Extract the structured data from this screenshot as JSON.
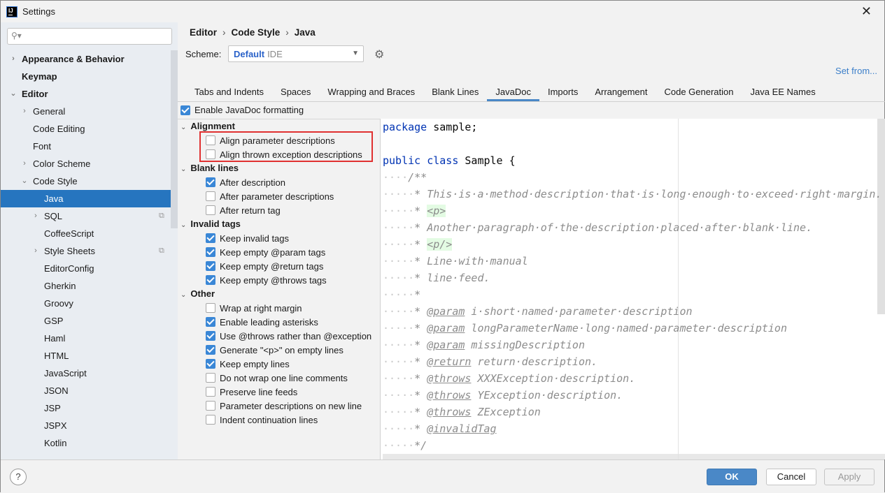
{
  "window": {
    "title": "Settings",
    "icon": "intellij-icon",
    "close": "✕"
  },
  "sidebar": {
    "search_placeholder": "",
    "items": [
      {
        "label": "Appearance & Behavior",
        "level": 0,
        "bold": true,
        "arrow": "›"
      },
      {
        "label": "Keymap",
        "level": 0,
        "bold": true,
        "arrow": ""
      },
      {
        "label": "Editor",
        "level": 0,
        "bold": true,
        "arrow": "⌄"
      },
      {
        "label": "General",
        "level": 1,
        "arrow": "›"
      },
      {
        "label": "Code Editing",
        "level": 1,
        "arrow": ""
      },
      {
        "label": "Font",
        "level": 1,
        "arrow": ""
      },
      {
        "label": "Color Scheme",
        "level": 1,
        "arrow": "›"
      },
      {
        "label": "Code Style",
        "level": 1,
        "arrow": "⌄"
      },
      {
        "label": "Java",
        "level": 2,
        "arrow": "",
        "selected": true
      },
      {
        "label": "SQL",
        "level": 2,
        "arrow": "›",
        "copy": true
      },
      {
        "label": "CoffeeScript",
        "level": 2,
        "arrow": ""
      },
      {
        "label": "Style Sheets",
        "level": 2,
        "arrow": "›",
        "copy": true
      },
      {
        "label": "EditorConfig",
        "level": 2,
        "arrow": ""
      },
      {
        "label": "Gherkin",
        "level": 2,
        "arrow": ""
      },
      {
        "label": "Groovy",
        "level": 2,
        "arrow": ""
      },
      {
        "label": "GSP",
        "level": 2,
        "arrow": ""
      },
      {
        "label": "Haml",
        "level": 2,
        "arrow": ""
      },
      {
        "label": "HTML",
        "level": 2,
        "arrow": ""
      },
      {
        "label": "JavaScript",
        "level": 2,
        "arrow": ""
      },
      {
        "label": "JSON",
        "level": 2,
        "arrow": ""
      },
      {
        "label": "JSP",
        "level": 2,
        "arrow": ""
      },
      {
        "label": "JSPX",
        "level": 2,
        "arrow": ""
      },
      {
        "label": "Kotlin",
        "level": 2,
        "arrow": ""
      }
    ]
  },
  "breadcrumb": [
    "Editor",
    "Code Style",
    "Java"
  ],
  "breadcrumb_sep": "›",
  "scheme": {
    "label": "Scheme:",
    "name": "Default",
    "type": "IDE"
  },
  "set_from": "Set from...",
  "tabs": [
    {
      "label": "Tabs and Indents"
    },
    {
      "label": "Spaces"
    },
    {
      "label": "Wrapping and Braces"
    },
    {
      "label": "Blank Lines"
    },
    {
      "label": "JavaDoc",
      "active": true
    },
    {
      "label": "Imports"
    },
    {
      "label": "Arrangement"
    },
    {
      "label": "Code Generation"
    },
    {
      "label": "Java EE Names"
    }
  ],
  "enable_javadoc": {
    "label": "Enable JavaDoc formatting",
    "checked": true
  },
  "groups": [
    {
      "title": "Alignment",
      "options": [
        {
          "label": "Align parameter descriptions",
          "checked": false
        },
        {
          "label": "Align thrown exception descriptions",
          "checked": false
        }
      ]
    },
    {
      "title": "Blank lines",
      "options": [
        {
          "label": "After description",
          "checked": true
        },
        {
          "label": "After parameter descriptions",
          "checked": false
        },
        {
          "label": "After return tag",
          "checked": false
        }
      ]
    },
    {
      "title": "Invalid tags",
      "options": [
        {
          "label": "Keep invalid tags",
          "checked": true
        },
        {
          "label": "Keep empty @param tags",
          "checked": true
        },
        {
          "label": "Keep empty @return tags",
          "checked": true
        },
        {
          "label": "Keep empty @throws tags",
          "checked": true
        }
      ]
    },
    {
      "title": "Other",
      "options": [
        {
          "label": "Wrap at right margin",
          "checked": false
        },
        {
          "label": "Enable leading asterisks",
          "checked": true
        },
        {
          "label": "Use @throws rather than @exception",
          "checked": true
        },
        {
          "label": "Generate \"<p>\" on empty lines",
          "checked": true
        },
        {
          "label": "Keep empty lines",
          "checked": true
        },
        {
          "label": "Do not wrap one line comments",
          "checked": false
        },
        {
          "label": "Preserve line feeds",
          "checked": false
        },
        {
          "label": "Parameter descriptions on new line",
          "checked": false
        },
        {
          "label": "Indent continuation lines",
          "checked": false
        }
      ]
    }
  ],
  "code": [
    {
      "dots": 0,
      "code": true,
      "parts": [
        {
          "t": "package",
          "c": "kw"
        },
        {
          "t": " sample;"
        }
      ]
    },
    {
      "dots": 0,
      "code": true,
      "parts": []
    },
    {
      "dots": 0,
      "code": true,
      "parts": [
        {
          "t": "public",
          "c": "kw"
        },
        {
          "t": " "
        },
        {
          "t": "class",
          "c": "kw"
        },
        {
          "t": " Sample {"
        }
      ]
    },
    {
      "dots": 4,
      "parts": [
        {
          "t": "/**"
        }
      ]
    },
    {
      "dots": 5,
      "parts": [
        {
          "t": "* This·is·a·method·description·that·is·long·enough·to·exceed·right·margin."
        }
      ]
    },
    {
      "dots": 5,
      "parts": [
        {
          "t": "* "
        },
        {
          "t": "<p>",
          "c": "html"
        }
      ]
    },
    {
      "dots": 5,
      "parts": [
        {
          "t": "* Another·paragraph·of·the·description·placed·after·blank·line."
        }
      ]
    },
    {
      "dots": 5,
      "parts": [
        {
          "t": "* "
        },
        {
          "t": "<p/>",
          "c": "html"
        }
      ]
    },
    {
      "dots": 5,
      "parts": [
        {
          "t": "* Line·with·manual"
        }
      ]
    },
    {
      "dots": 5,
      "parts": [
        {
          "t": "* line·feed."
        }
      ]
    },
    {
      "dots": 5,
      "parts": [
        {
          "t": "*"
        }
      ]
    },
    {
      "dots": 5,
      "parts": [
        {
          "t": "* "
        },
        {
          "t": "@param",
          "c": "tag"
        },
        {
          "t": " i·short·named·parameter·description"
        }
      ]
    },
    {
      "dots": 5,
      "parts": [
        {
          "t": "* "
        },
        {
          "t": "@param",
          "c": "tag"
        },
        {
          "t": " longParameterName·long·named·parameter·description"
        }
      ]
    },
    {
      "dots": 5,
      "parts": [
        {
          "t": "* "
        },
        {
          "t": "@param",
          "c": "tag"
        },
        {
          "t": " missingDescription"
        }
      ]
    },
    {
      "dots": 5,
      "parts": [
        {
          "t": "* "
        },
        {
          "t": "@return",
          "c": "tag"
        },
        {
          "t": " return·description."
        }
      ]
    },
    {
      "dots": 5,
      "parts": [
        {
          "t": "* "
        },
        {
          "t": "@throws",
          "c": "tag"
        },
        {
          "t": " XXXException·description."
        }
      ]
    },
    {
      "dots": 5,
      "parts": [
        {
          "t": "* "
        },
        {
          "t": "@throws",
          "c": "tag"
        },
        {
          "t": " YException·description."
        }
      ]
    },
    {
      "dots": 5,
      "parts": [
        {
          "t": "* "
        },
        {
          "t": "@throws",
          "c": "tag"
        },
        {
          "t": " ZException"
        }
      ]
    },
    {
      "dots": 5,
      "parts": [
        {
          "t": "* "
        },
        {
          "t": "@invalidTag",
          "c": "tag"
        }
      ]
    },
    {
      "dots": 5,
      "parts": [
        {
          "t": "*/"
        }
      ]
    }
  ],
  "buttons": {
    "help": "?",
    "ok": "OK",
    "cancel": "Cancel",
    "apply": "Apply"
  },
  "colors": {
    "accent": "#2675bf",
    "ok_button": "#4a88c7",
    "highlight_box": "#e03131",
    "keyword": "#0033b3"
  }
}
